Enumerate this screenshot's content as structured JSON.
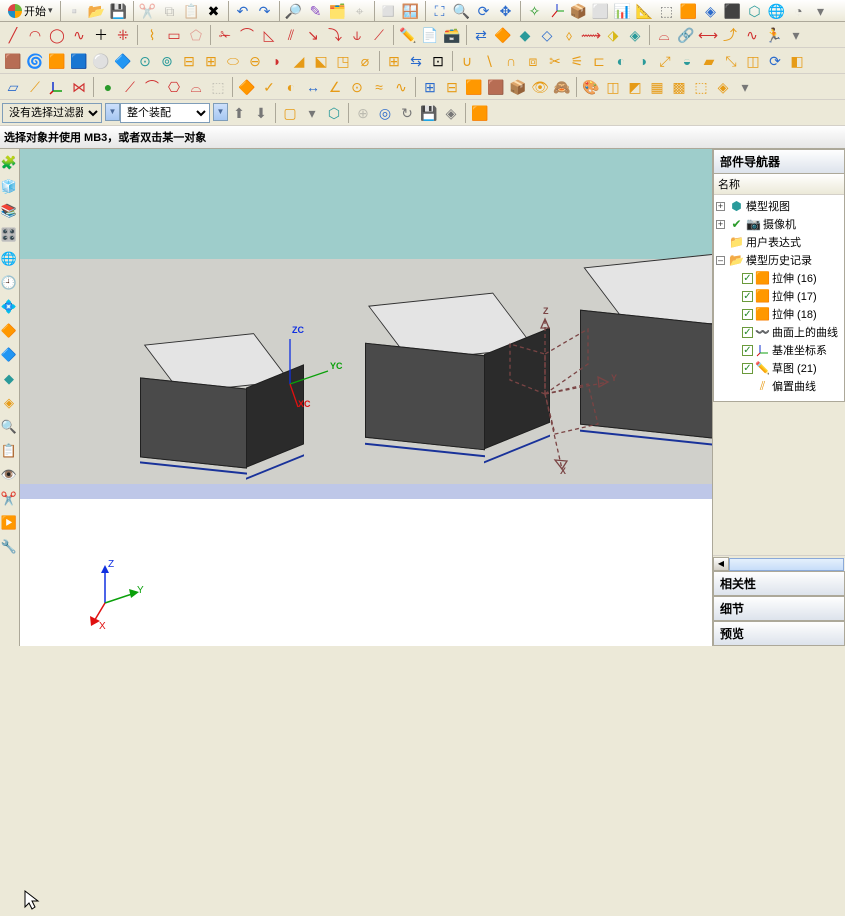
{
  "menu": {
    "start": "开始",
    "arrow": "▾"
  },
  "filters": {
    "sel1": "没有选择过滤器",
    "sel2": "整个装配"
  },
  "message": "选择对象并使用 MB3，或者双击某一对象",
  "viewport": {
    "axis_labels": {
      "zc": "ZC",
      "yc": "YC",
      "xc": "XC",
      "z": "Z",
      "y": "Y",
      "x": "X"
    }
  },
  "nav": {
    "title": "部件导航器",
    "col": "名称",
    "nodes": {
      "modelview": "模型视图",
      "camera": "摄像机",
      "userexpr": "用户表达式",
      "history": "模型历史记录",
      "ext16": "拉伸 (16)",
      "ext17": "拉伸 (17)",
      "ext18": "拉伸 (18)",
      "surfcurve": "曲面上的曲线",
      "datumcsys": "基准坐标系",
      "sketch21": "草图 (21)",
      "offsetcurve": "偏置曲线"
    }
  },
  "right_panels": {
    "related": "相关性",
    "details": "细节",
    "preview": "预览"
  }
}
